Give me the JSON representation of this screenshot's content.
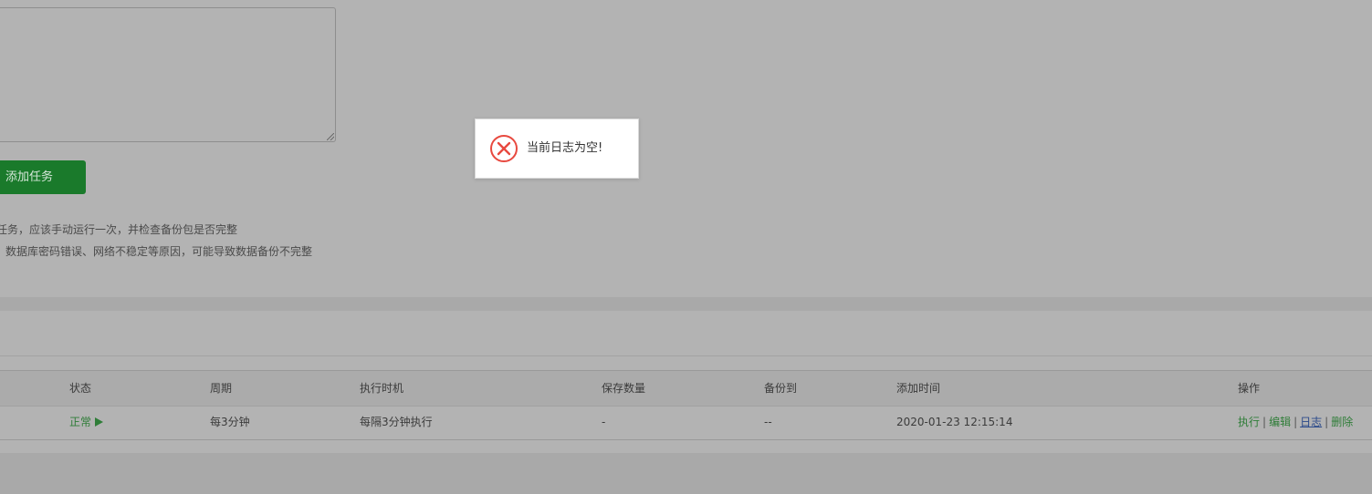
{
  "form": {
    "add_task_label": "添加任务",
    "tips": [
      "任务，应该手动运行一次，并检查备份包是否完整",
      "数据库密码错误、网络不稳定等原因，可能导致数据备份不完整"
    ]
  },
  "table": {
    "headers": {
      "status": "状态",
      "cycle": "周期",
      "exec_time": "执行时机",
      "keep_count": "保存数量",
      "backup_to": "备份到",
      "added_time": "添加时间",
      "operations": "操作"
    },
    "rows": [
      {
        "status": "正常",
        "cycle": "每3分钟",
        "exec_time": "每隔3分钟执行",
        "keep_count": "-",
        "backup_to": "--",
        "added_time": "2020-01-23 12:15:14",
        "ops": {
          "run": "执行",
          "edit": "编辑",
          "log": "日志",
          "delete": "删除",
          "separator": "|"
        }
      }
    ]
  },
  "toast": {
    "message": "当前日志为空!",
    "icon": "error-x-icon",
    "icon_color": "#e8493f"
  },
  "colors": {
    "accent_green": "#1a7a2b",
    "status_green": "#2f7d38",
    "overlay_gray": "#b3b3b3"
  }
}
